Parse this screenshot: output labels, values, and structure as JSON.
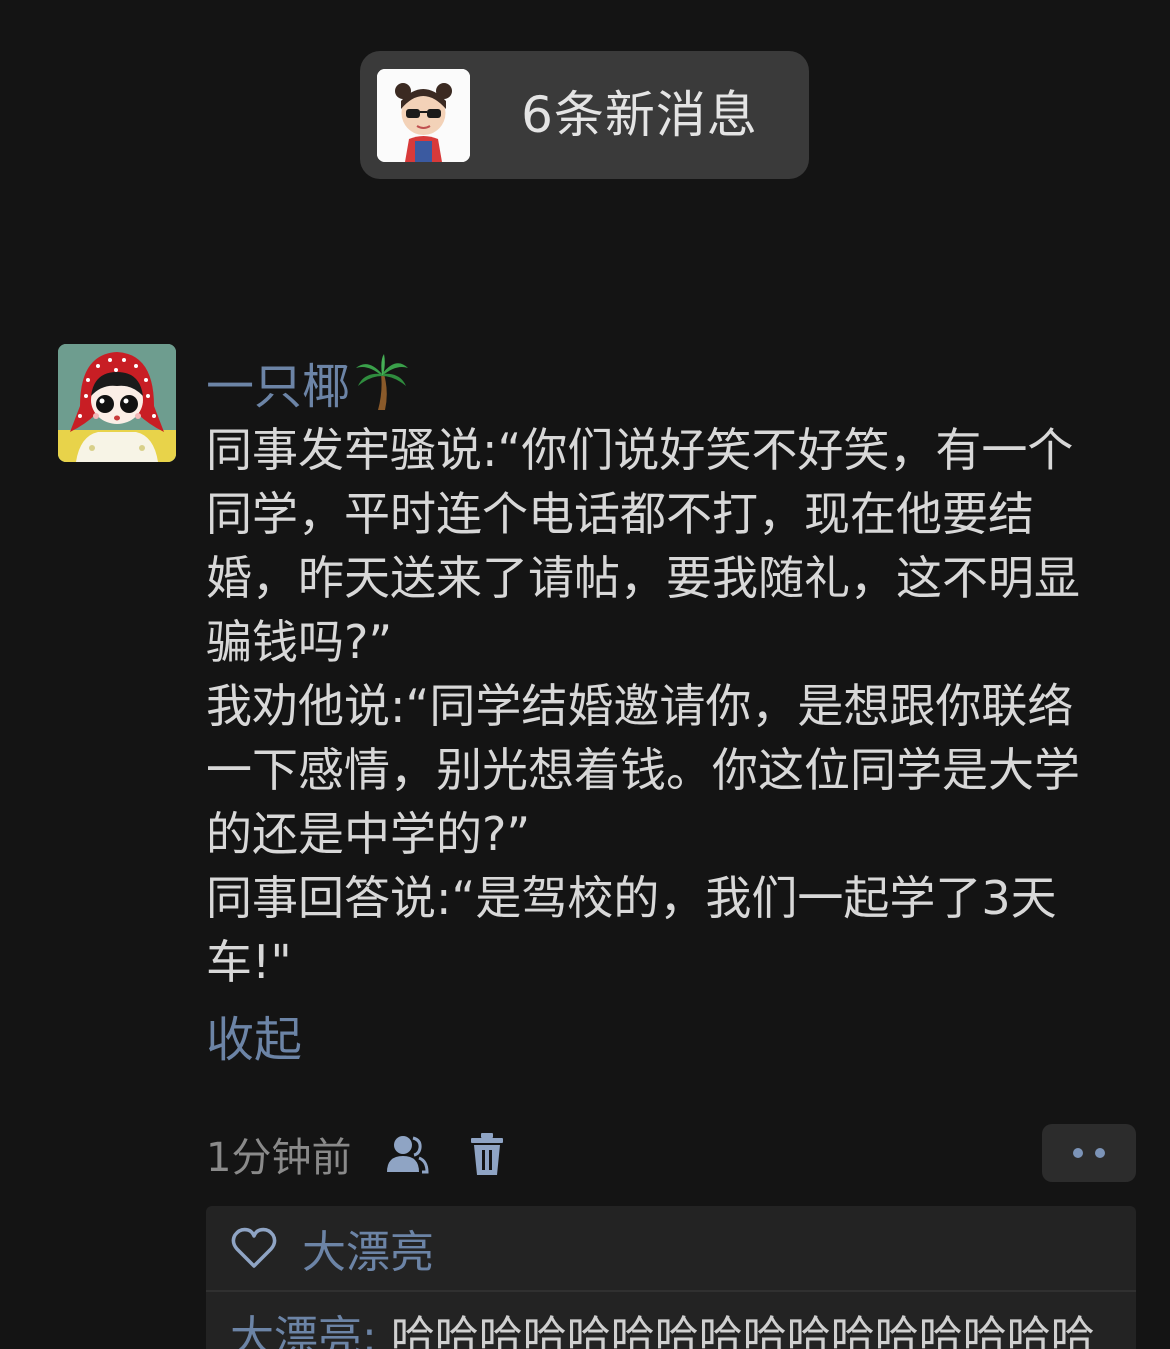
{
  "new_messages": {
    "label": "6条新消息",
    "avatar_icon": "cartoon-girl-sunglasses-avatar"
  },
  "post": {
    "author": "一只椰",
    "author_emoji": "palm-tree-icon",
    "avatar_icon": "girl-red-headscarf-avatar",
    "paragraphs": [
      "同事发牢骚说:“你们说好笑不好笑，有一个同学，平时连个电话都不打，现在他要结婚，昨天送来了请帖，要我随礼，这不明显骗钱吗?”",
      "我劝他说:“同学结婚邀请你，是想跟你联络一下感情，别光想着钱。你这位同学是大学的还是中学的?”",
      "同事回答说:“是驾校的，我们一起学了3天车!\""
    ],
    "collapse_label": "收起",
    "time": "1分钟前",
    "visibility_icon": "friends-icon",
    "delete_icon": "trash-icon",
    "more_icon": "more-dots-icon"
  },
  "interactions": {
    "like_icon": "heart-icon",
    "likes": "大漂亮",
    "comments": [
      {
        "author": "大漂亮",
        "separator": ": ",
        "text": "哈哈哈哈哈哈哈哈哈哈哈哈哈哈哈哈"
      }
    ]
  },
  "colors": {
    "background": "#141414",
    "link_blue": "#6c84a6",
    "text": "#d8d8d8",
    "pill_bg": "#3a3a3a"
  }
}
